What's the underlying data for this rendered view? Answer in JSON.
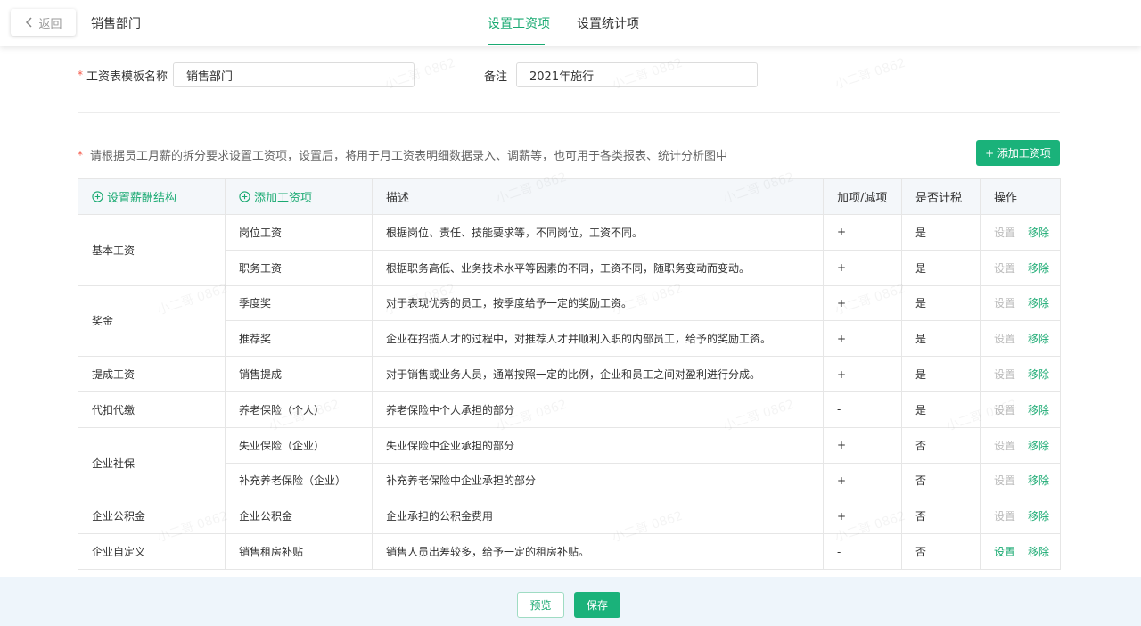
{
  "header": {
    "back_label": "返回",
    "page_name": "销售部门",
    "tabs": [
      {
        "label": "设置工资项",
        "active": true
      },
      {
        "label": "设置统计项",
        "active": false
      }
    ]
  },
  "form": {
    "template_name_label": "工资表模板名称",
    "template_name_value": "销售部门",
    "remark_label": "备注",
    "remark_value": "2021年施行"
  },
  "hint": "请根据员工月薪的拆分要求设置工资项，设置后，将用于月工资表明细数据录入、调薪等，也可用于各类报表、统计分析图中",
  "add_item_button": "+ 添加工资项",
  "table": {
    "headers": {
      "structure": "设置薪酬结构",
      "item": "添加工资项",
      "description": "描述",
      "add_sub": "加项/减项",
      "taxable": "是否计税",
      "operation": "操作"
    },
    "op_setting": "设置",
    "op_remove": "移除",
    "groups": [
      {
        "category": "基本工资",
        "rows": [
          {
            "item": "岗位工资",
            "desc": "根据岗位、责任、技能要求等，不同岗位，工资不同。",
            "sign": "+",
            "tax": "是"
          },
          {
            "item": "职务工资",
            "desc": "根据职务高低、业务技术水平等因素的不同，工资不同，随职务变动而变动。",
            "sign": "+",
            "tax": "是"
          }
        ]
      },
      {
        "category": "奖金",
        "rows": [
          {
            "item": "季度奖",
            "desc": "对于表现优秀的员工，按季度给予一定的奖励工资。",
            "sign": "+",
            "tax": "是"
          },
          {
            "item": "推荐奖",
            "desc": "企业在招揽人才的过程中，对推荐人才并顺利入职的内部员工，给予的奖励工资。",
            "sign": "+",
            "tax": "是"
          }
        ]
      },
      {
        "category": "提成工资",
        "rows": [
          {
            "item": "销售提成",
            "desc": "对于销售或业务人员，通常按照一定的比例，企业和员工之间对盈利进行分成。",
            "sign": "+",
            "tax": "是"
          }
        ]
      },
      {
        "category": "代扣代缴",
        "rows": [
          {
            "item": "养老保险（个人）",
            "desc": "养老保险中个人承担的部分",
            "sign": "-",
            "tax": "是"
          }
        ]
      },
      {
        "category": "企业社保",
        "rows": [
          {
            "item": "失业保险（企业）",
            "desc": "失业保险中企业承担的部分",
            "sign": "+",
            "tax": "否"
          },
          {
            "item": "补充养老保险（企业）",
            "desc": "补充养老保险中企业承担的部分",
            "sign": "+",
            "tax": "否"
          }
        ]
      },
      {
        "category": "企业公积金",
        "rows": [
          {
            "item": "企业公积金",
            "desc": "企业承担的公积金费用",
            "sign": "+",
            "tax": "否"
          }
        ]
      },
      {
        "category": "企业自定义",
        "rows": [
          {
            "item": "销售租房补贴",
            "desc": "销售人员出差较多，给予一定的租房补贴。",
            "sign": "-",
            "tax": "否",
            "setting_enabled": true
          }
        ]
      }
    ]
  },
  "watermark_text": "小二哥 0862",
  "footer": {
    "preview_label": "预览",
    "save_label": "保存"
  },
  "colors": {
    "accent": "#1aaa72",
    "required": "#f5594a",
    "footer_bg": "#eef5fb"
  }
}
